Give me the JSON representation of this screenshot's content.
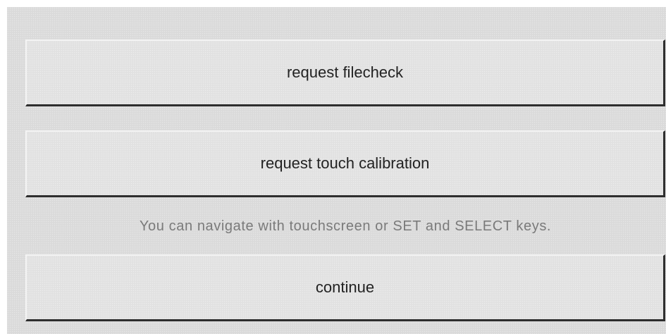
{
  "buttons": {
    "filecheck_label": "request filecheck",
    "touch_calibration_label": "request touch calibration",
    "continue_label": "continue"
  },
  "hint": {
    "text": "You can navigate with touchscreen or SET and SELECT keys."
  }
}
